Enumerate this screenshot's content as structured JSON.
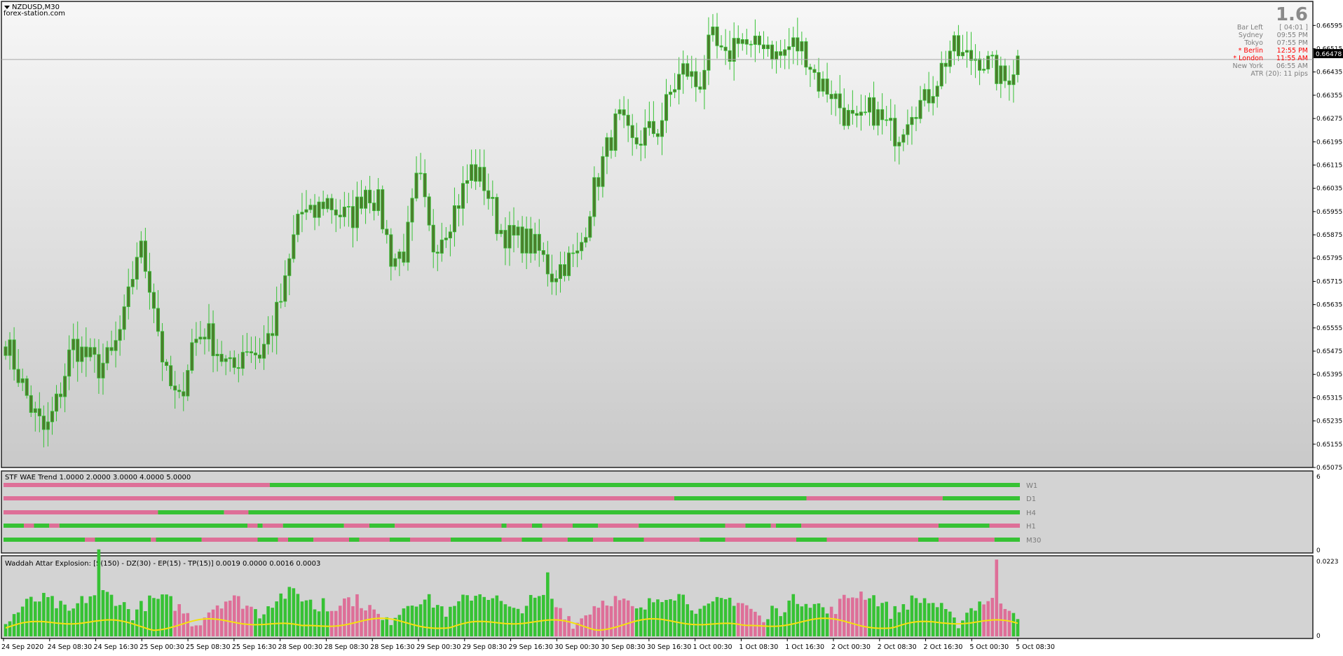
{
  "window": {
    "symbol_title": "NZDUSD,M30",
    "watermark": "forex-station.com"
  },
  "info_panel": {
    "big_number": "1.6",
    "bar_left_label": "Bar Left",
    "bar_left_value": "[ 04:01 ]",
    "sessions": [
      {
        "name": "Sydney",
        "time": "09:55 PM",
        "active": false
      },
      {
        "name": "Tokyo",
        "time": "07:55 PM",
        "active": false
      },
      {
        "name": "* Berlin",
        "time": "12:55 PM",
        "active": true
      },
      {
        "name": "* London",
        "time": "11:55 AM",
        "active": true
      },
      {
        "name": "New York",
        "time": "06:55 AM",
        "active": false
      }
    ],
    "atr_text": "ATR (20): 11 pips"
  },
  "price_axis": {
    "labels": [
      "0.66595",
      "0.66515",
      "0.66435",
      "0.66355",
      "0.66275",
      "0.66195",
      "0.66115",
      "0.66035",
      "0.65955",
      "0.65875",
      "0.65795",
      "0.65715",
      "0.65635",
      "0.65555",
      "0.65475",
      "0.65395",
      "0.65315",
      "0.65235",
      "0.65155",
      "0.65075"
    ],
    "current_price": "0.66478"
  },
  "stf_panel": {
    "title": "STF WAE Trend 1.0000 2.0000 3.0000 4.0000 5.0000",
    "timeframes": [
      "W1",
      "D1",
      "H4",
      "H1",
      "M30"
    ],
    "axis_top": "6",
    "axis_bottom": "0"
  },
  "wae_panel": {
    "title": "Waddah Attar Explosion: [S(150) - DZ(30) - EP(15) - TP(15)] 0.0019 0.0000 0.0016 0.0003",
    "axis_top": "0.0223",
    "axis_bottom": "0"
  },
  "time_axis": {
    "labels": [
      "24 Sep 2020",
      "24 Sep 08:30",
      "24 Sep 16:30",
      "25 Sep 00:30",
      "25 Sep 08:30",
      "25 Sep 16:30",
      "28 Sep 00:30",
      "28 Sep 08:30",
      "28 Sep 16:30",
      "29 Sep 00:30",
      "29 Sep 08:30",
      "29 Sep 16:30",
      "30 Sep 00:30",
      "30 Sep 08:30",
      "30 Sep 16:30",
      "1 Oct 00:30",
      "1 Oct 08:30",
      "1 Oct 16:30",
      "2 Oct 00:30",
      "2 Oct 08:30",
      "2 Oct 16:30",
      "5 Oct 00:30",
      "5 Oct 08:30"
    ]
  },
  "chart_data": {
    "type": "candlestick",
    "symbol": "NZDUSD",
    "timeframe": "M30",
    "bar_count": 240,
    "y_range": [
      0.65075,
      0.66615
    ],
    "close_anchors": [
      0.6551,
      0.6539,
      0.6527,
      0.6519,
      0.6532,
      0.655,
      0.6546,
      0.6542,
      0.6546,
      0.656,
      0.6585,
      0.6568,
      0.6539,
      0.6529,
      0.655,
      0.6555,
      0.6547,
      0.654,
      0.655,
      0.6546,
      0.6555,
      0.657,
      0.6596,
      0.6593,
      0.66,
      0.6595,
      0.6593,
      0.6604,
      0.6598,
      0.6579,
      0.6582,
      0.6609,
      0.6583,
      0.659,
      0.6599,
      0.661,
      0.6605,
      0.659,
      0.6586,
      0.6586,
      0.6582,
      0.6574,
      0.6578,
      0.658,
      0.66,
      0.6615,
      0.6628,
      0.6618,
      0.6622,
      0.6624,
      0.6637,
      0.6645,
      0.6638,
      0.6655,
      0.6646,
      0.6657,
      0.665,
      0.6655,
      0.6648,
      0.6653,
      0.6651,
      0.664,
      0.6637,
      0.6629,
      0.6624,
      0.6631,
      0.6625,
      0.6622,
      0.6632,
      0.6633,
      0.6642,
      0.6652,
      0.6648,
      0.6649,
      0.6645,
      0.664,
      0.6648
    ],
    "stf_rows": [
      [
        [
          0,
          0.262,
          "bear"
        ],
        [
          0.262,
          1,
          "bull"
        ]
      ],
      [
        [
          0,
          0.66,
          "bear"
        ],
        [
          0.66,
          0.79,
          "bull"
        ],
        [
          0.79,
          0.924,
          "bear"
        ],
        [
          0.924,
          1,
          "bull"
        ]
      ],
      [
        [
          0,
          0.152,
          "bear"
        ],
        [
          0.152,
          0.217,
          "bull"
        ],
        [
          0.217,
          0.241,
          "bear"
        ],
        [
          0.241,
          1,
          "bull"
        ]
      ],
      [
        [
          0,
          0.02,
          "bull"
        ],
        [
          0.02,
          0.03,
          "bear"
        ],
        [
          0.03,
          0.045,
          "bull"
        ],
        [
          0.045,
          0.055,
          "bear"
        ],
        [
          0.055,
          0.24,
          "bull"
        ],
        [
          0.24,
          0.25,
          "bear"
        ],
        [
          0.25,
          0.255,
          "bull"
        ],
        [
          0.255,
          0.275,
          "bear"
        ],
        [
          0.275,
          0.335,
          "bull"
        ],
        [
          0.335,
          0.36,
          "bear"
        ],
        [
          0.36,
          0.385,
          "bull"
        ],
        [
          0.385,
          0.49,
          "bear"
        ],
        [
          0.49,
          0.495,
          "bull"
        ],
        [
          0.495,
          0.52,
          "bear"
        ],
        [
          0.52,
          0.53,
          "bull"
        ],
        [
          0.53,
          0.56,
          "bear"
        ],
        [
          0.56,
          0.585,
          "bull"
        ],
        [
          0.585,
          0.625,
          "bear"
        ],
        [
          0.625,
          0.71,
          "bull"
        ],
        [
          0.71,
          0.73,
          "bear"
        ],
        [
          0.73,
          0.755,
          "bull"
        ],
        [
          0.755,
          0.76,
          "bear"
        ],
        [
          0.76,
          0.785,
          "bull"
        ],
        [
          0.785,
          0.92,
          "bear"
        ],
        [
          0.92,
          0.97,
          "bull"
        ],
        [
          0.97,
          1,
          "bear"
        ]
      ],
      [
        [
          0,
          0.08,
          "bull"
        ],
        [
          0.08,
          0.09,
          "bear"
        ],
        [
          0.09,
          0.145,
          "bull"
        ],
        [
          0.145,
          0.15,
          "bear"
        ],
        [
          0.15,
          0.195,
          "bull"
        ],
        [
          0.195,
          0.25,
          "bear"
        ],
        [
          0.25,
          0.27,
          "bull"
        ],
        [
          0.27,
          0.28,
          "bear"
        ],
        [
          0.28,
          0.305,
          "bull"
        ],
        [
          0.305,
          0.34,
          "bear"
        ],
        [
          0.34,
          0.35,
          "bull"
        ],
        [
          0.35,
          0.38,
          "bear"
        ],
        [
          0.38,
          0.4,
          "bull"
        ],
        [
          0.4,
          0.44,
          "bear"
        ],
        [
          0.44,
          0.49,
          "bull"
        ],
        [
          0.49,
          0.51,
          "bear"
        ],
        [
          0.51,
          0.53,
          "bull"
        ],
        [
          0.53,
          0.555,
          "bear"
        ],
        [
          0.555,
          0.58,
          "bull"
        ],
        [
          0.58,
          0.6,
          "bear"
        ],
        [
          0.6,
          0.63,
          "bull"
        ],
        [
          0.63,
          0.685,
          "bear"
        ],
        [
          0.685,
          0.71,
          "bull"
        ],
        [
          0.71,
          0.78,
          "bear"
        ],
        [
          0.78,
          0.81,
          "bull"
        ],
        [
          0.81,
          0.9,
          "bear"
        ],
        [
          0.9,
          0.92,
          "bull"
        ],
        [
          0.92,
          0.975,
          "bear"
        ],
        [
          0.975,
          1,
          "bull"
        ]
      ]
    ],
    "wae_bear_ranges": [
      [
        0.165,
        0.245
      ],
      [
        0.32,
        0.37
      ],
      [
        0.54,
        0.62
      ],
      [
        0.72,
        0.75
      ],
      [
        0.81,
        0.85
      ],
      [
        0.96,
        0.99
      ]
    ]
  },
  "colors": {
    "bull": "#36c234",
    "bear": "#de6f98",
    "candle_body": "#4c7d2c",
    "explosion_line": "#f4e10e",
    "price_tag_bg": "#000000",
    "session_active": "#ff0000",
    "session_inactive": "#7f7f7f"
  }
}
